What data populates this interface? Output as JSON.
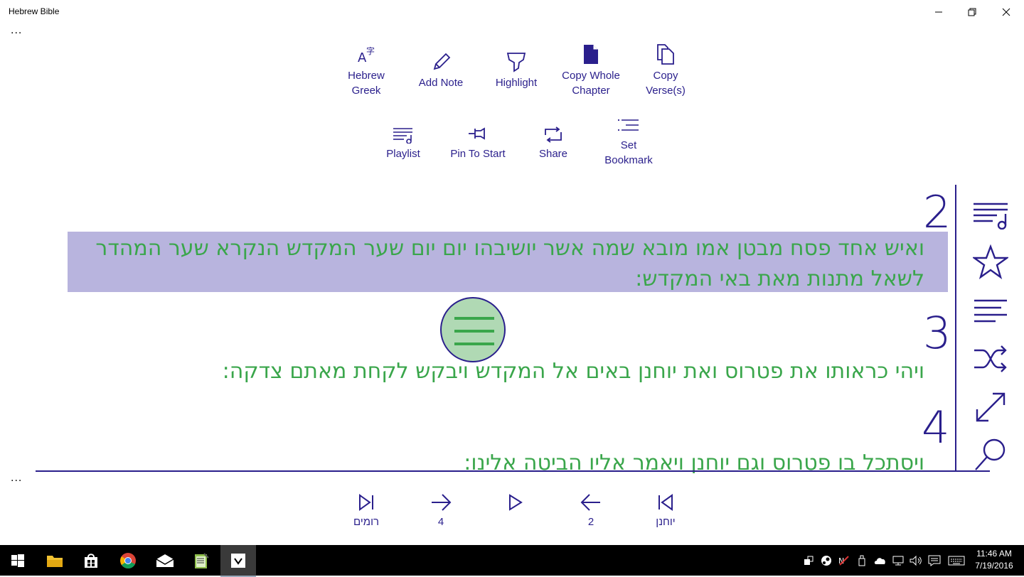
{
  "window": {
    "title": "Hebrew Bible"
  },
  "top_more": "...",
  "bottom_more": "...",
  "commands_row1": [
    {
      "label": "Hebrew\nGreek",
      "icon": "language-icon"
    },
    {
      "label": "Add Note",
      "icon": "pencil-icon"
    },
    {
      "label": "Highlight",
      "icon": "highlighter-icon"
    },
    {
      "label": "Copy Whole\nChapter",
      "icon": "document-icon"
    },
    {
      "label": "Copy\nVerse(s)",
      "icon": "copy-icon"
    }
  ],
  "commands_row2": [
    {
      "label": "Playlist",
      "icon": "playlist-icon"
    },
    {
      "label": "Pin To Start",
      "icon": "pin-icon"
    },
    {
      "label": "Share",
      "icon": "share-icon"
    },
    {
      "label": "Set\nBookmark",
      "icon": "bookmark-list-icon"
    }
  ],
  "verses": [
    {
      "number": "2",
      "text": "ואיש אחד פסח מבטן אמו מובא שמה אשר יושיבהו יום יום שער המקדש הנקרא שער המהדר לשאל מתנות מאת באי המקדש:",
      "highlighted": true
    },
    {
      "number": "3",
      "text": "ויהי כראותו את פטרוס ואת יוחנן באים אל המקדש ויבקש לקחת מאתם צדקה:",
      "highlighted": false
    },
    {
      "number": "4",
      "text": "ויסתכל בו פטרוס וגם יוחנן ויאמר אליו הביטה אלינו:",
      "highlighted": false
    }
  ],
  "colors": {
    "accent": "#2a1f8c",
    "verse_text": "#3aa64b",
    "highlight": "#b8b4de",
    "fab": "#b0d9b4"
  },
  "sidebar": [
    "playlist-icon",
    "star-icon",
    "lines-icon",
    "shuffle-icon",
    "expand-icon",
    "search-icon"
  ],
  "bottom_nav": [
    {
      "label": "רומים",
      "icon": "skip-forward-icon"
    },
    {
      "label": "4",
      "icon": "arrow-right-icon"
    },
    {
      "label": "",
      "icon": "play-icon"
    },
    {
      "label": "2",
      "icon": "arrow-left-icon"
    },
    {
      "label": "יוחנן",
      "icon": "skip-back-icon"
    }
  ],
  "taskbar": {
    "time": "11:46 AM",
    "date": "7/19/2016"
  }
}
